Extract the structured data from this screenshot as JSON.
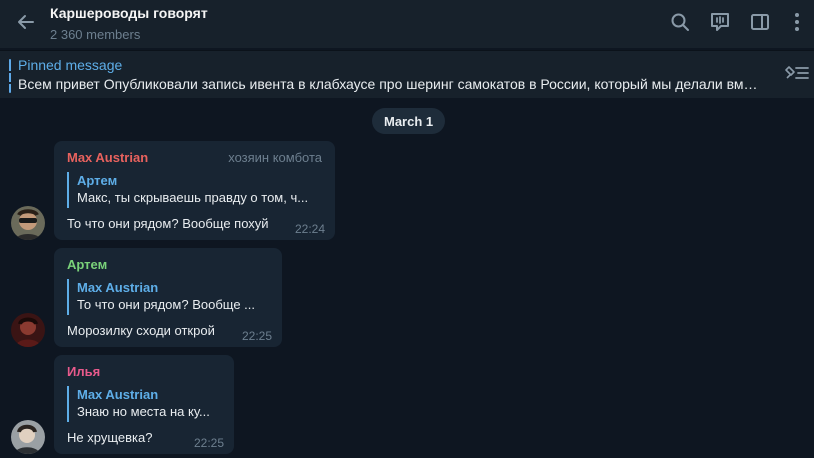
{
  "header": {
    "title": "Каршероводы говорят",
    "subtitle": "2 360 members",
    "back_icon": "arrow-left-icon",
    "icons": [
      "search-icon",
      "live-stream-icon",
      "sidebar-toggle-icon",
      "more-vertical-icon"
    ]
  },
  "pinned": {
    "label": "Pinned message",
    "text": "Всем привет   Опубликовали запись ивента в клабхаусе про шеринг самокатов в России, который мы делали вмес...",
    "icon": "pin-list-icon"
  },
  "date_divider": "March 1",
  "colors": {
    "background": "#0e1621",
    "header": "#17212b",
    "bubble": "#182533",
    "accent": "#5eaee8",
    "name_red": "#e8625e",
    "name_green": "#7ad27a",
    "name_pink": "#e85a8c"
  },
  "messages": [
    {
      "sender": "Max Austrian",
      "role": "хозяин комбота",
      "reply_name": "Артем",
      "reply_text": "Макс, ты скрываешь правду о том, ч...",
      "text": "То что они рядом? Вообще похуй",
      "time": "22:24"
    },
    {
      "sender": "Артем",
      "reply_name": "Max Austrian",
      "reply_text": "То что они рядом? Вообще ...",
      "text": "Морозилку сходи открой",
      "time": "22:25"
    },
    {
      "sender": "Илья",
      "reply_name": "Max Austrian",
      "reply_text": "Знаю но места на ку...",
      "text": "Не хрущевка?",
      "time": "22:25"
    }
  ]
}
